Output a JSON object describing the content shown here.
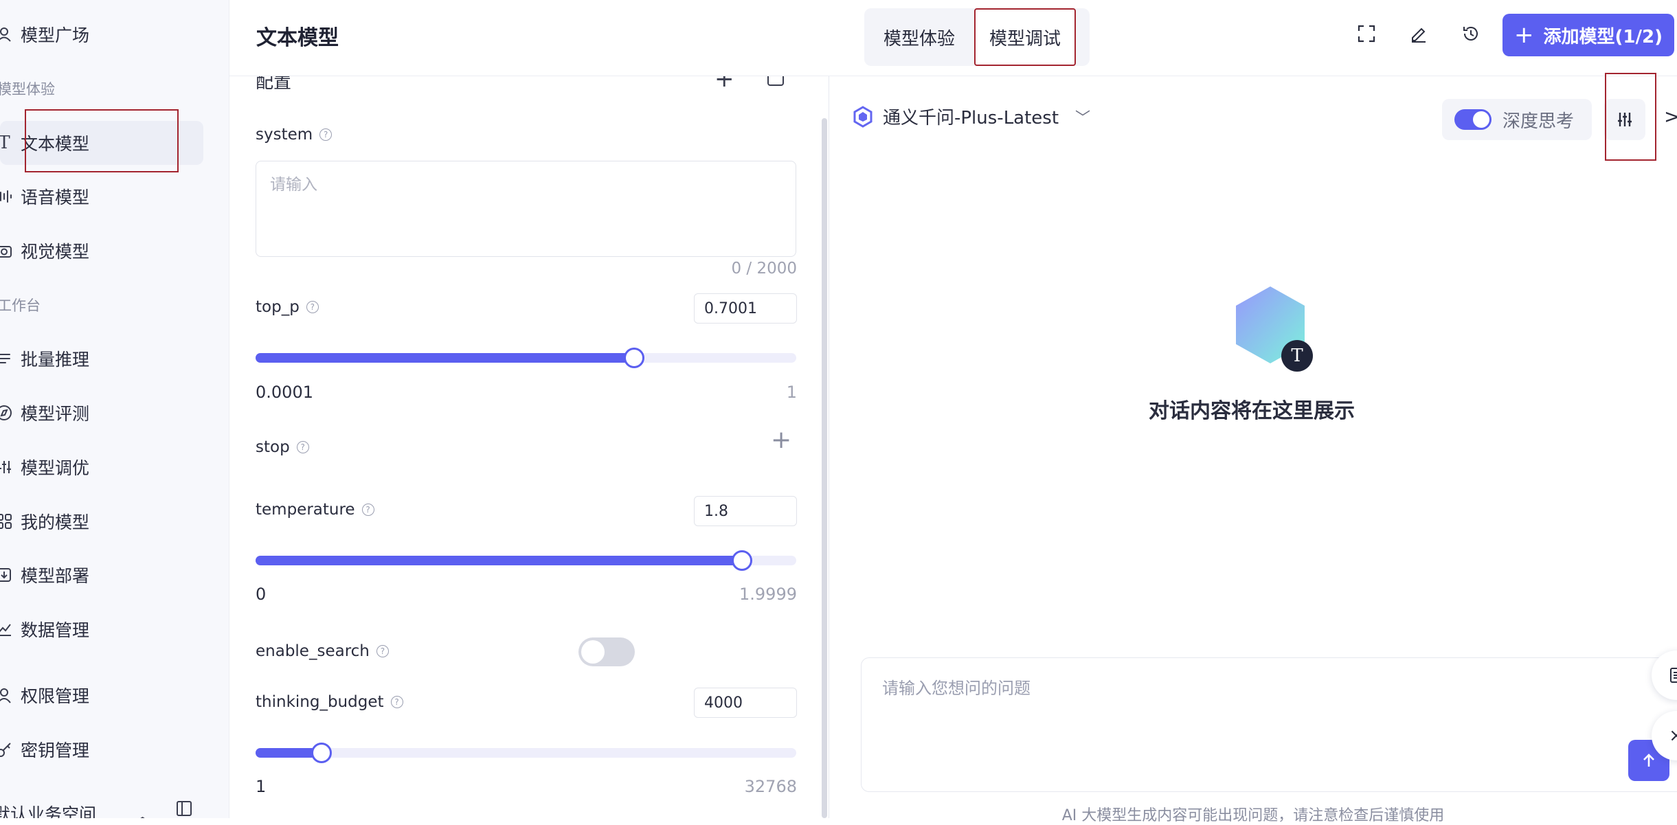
{
  "sidebar": {
    "top_item": {
      "label": "模型广场",
      "icon": "model-plaza-icon"
    },
    "group_experience": "模型体验",
    "experience_items": [
      {
        "label": "文本模型",
        "icon": "text-icon",
        "active": true
      },
      {
        "label": "语音模型",
        "icon": "audio-wave-icon"
      },
      {
        "label": "视觉模型",
        "icon": "camera-icon"
      }
    ],
    "group_workbench": "工作台",
    "workbench_items": [
      {
        "label": "批量推理",
        "icon": "list-icon"
      },
      {
        "label": "模型评测",
        "icon": "compass-icon"
      },
      {
        "label": "模型调优",
        "icon": "sliders-icon"
      },
      {
        "label": "我的模型",
        "icon": "grid-icon"
      },
      {
        "label": "模型部署",
        "icon": "deploy-icon"
      },
      {
        "label": "数据管理",
        "icon": "chart-icon"
      }
    ],
    "admin_items": [
      {
        "label": "权限管理",
        "icon": "user-icon"
      },
      {
        "label": "密钥管理",
        "icon": "key-icon"
      }
    ],
    "workspace_label": "默认业务空间"
  },
  "header": {
    "title": "文本模型",
    "tabs": [
      "模型体验",
      "模型调试"
    ],
    "add_model_label": "添加模型(1/2)"
  },
  "config": {
    "heading": "配置",
    "system_label": "system",
    "system_placeholder": "请输入",
    "system_counter": "0 / 2000",
    "top_p": {
      "label": "top_p",
      "value": "0.7001",
      "min": "0.0001",
      "max": "1",
      "fraction": 0.7
    },
    "stop_label": "stop",
    "temperature": {
      "label": "temperature",
      "value": "1.8",
      "min": "0",
      "max": "1.9999",
      "fraction": 0.9
    },
    "enable_search": {
      "label": "enable_search",
      "on": false
    },
    "thinking_budget": {
      "label": "thinking_budget",
      "value": "4000",
      "min": "1",
      "max": "32768",
      "fraction": 0.122
    }
  },
  "chat": {
    "model_name": "通义千问-Plus-Latest",
    "deep_think_label": "深度思考",
    "deep_think_on": true,
    "empty_badge": "T",
    "empty_text": "对话内容将在这里展示",
    "input_placeholder": "请输入您想问的问题",
    "disclaimer": "AI 大模型生成内容可能出现问题，请注意检查后谨慎使用"
  },
  "colors": {
    "accent": "#5b5ff0",
    "highlight_box": "#a3242f"
  }
}
